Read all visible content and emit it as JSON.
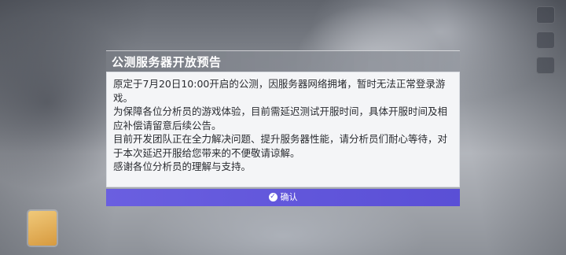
{
  "dialog": {
    "title": "公测服务器开放预告",
    "paragraphs": [
      "原定于7月20日10:00开启的公测，因服务器网络拥堵，暂时无法正常登录游戏。",
      "为保障各位分析员的游戏体验，目前需延迟测试开服时间，具体开服时间及相应补偿请留意后续公告。",
      "目前开发团队正在全力解决问题、提升服务器性能，请分析员们耐心等待，对于本次延迟开服给您带来的不便敬请谅解。",
      "感谢各位分析员的理解与支持。"
    ],
    "confirm_label": "确认"
  },
  "colors": {
    "accent": "#5a4fd6",
    "title_bar": "#7c8088",
    "body_bg": "#f4f5f7"
  },
  "icons": {
    "confirm": "check-circle-icon"
  }
}
